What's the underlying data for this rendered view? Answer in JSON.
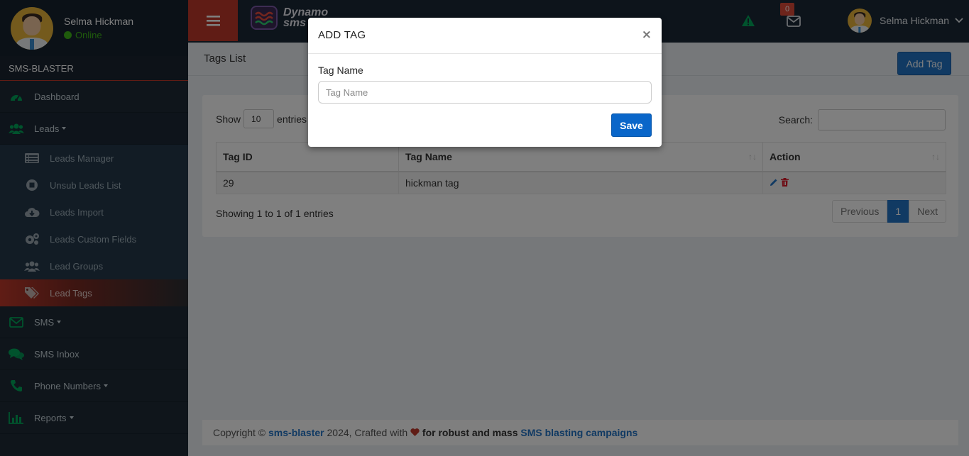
{
  "user": {
    "name": "Selma Hickman",
    "status": "Online"
  },
  "sidebar": {
    "app_name": "SMS-BLASTER",
    "items": [
      {
        "label": "Dashboard",
        "icon": "dashboard-icon"
      },
      {
        "label": "Leads",
        "icon": "users-icon",
        "has_caret": true
      },
      {
        "label": "SMS",
        "icon": "envelope-icon",
        "has_caret": true
      },
      {
        "label": "SMS Inbox",
        "icon": "comments-icon"
      },
      {
        "label": "Phone Numbers",
        "icon": "phone-icon",
        "has_caret": true
      },
      {
        "label": "Reports",
        "icon": "bar-chart-icon",
        "has_caret": true
      }
    ],
    "leads_submenu": [
      {
        "label": "Leads Manager",
        "icon": "list-icon"
      },
      {
        "label": "Unsub Leads List",
        "icon": "stop-circle-icon"
      },
      {
        "label": "Leads Import",
        "icon": "cloud-download-icon"
      },
      {
        "label": "Leads Custom Fields",
        "icon": "gears-icon"
      },
      {
        "label": "Lead Groups",
        "icon": "group-icon"
      },
      {
        "label": "Lead Tags",
        "icon": "tags-icon",
        "active": true
      }
    ]
  },
  "topbar": {
    "logo_line1": "Dynamo",
    "logo_line2": "sms",
    "mail_badge": "0",
    "user_name": "Selma Hickman"
  },
  "page": {
    "title": "Tags List",
    "add_button": "Add Tag"
  },
  "datatable": {
    "show_label": "Show",
    "page_length": "10",
    "entries_label": "entries",
    "search_label": "Search:",
    "columns": [
      "Tag ID",
      "Tag Name",
      "Action"
    ],
    "rows": [
      {
        "id": "29",
        "name": "hickman tag"
      }
    ],
    "info": "Showing 1 to 1 of 1 entries",
    "pagination": {
      "previous": "Previous",
      "current": "1",
      "next": "Next"
    }
  },
  "footer": {
    "prefix": "Copyright ©",
    "brand": "sms-blaster",
    "middle": "2024, Crafted with",
    "bold_text": "for robust and mass",
    "link_text": "SMS blasting campaigns"
  },
  "modal": {
    "title": "ADD TAG",
    "close": "×",
    "field_label": "Tag Name",
    "field_placeholder": "Tag Name",
    "field_value": "",
    "save": "Save"
  },
  "colors": {
    "accent_red": "#c0392b",
    "primary_blue": "#2374c6",
    "online_green": "#3fb618"
  }
}
